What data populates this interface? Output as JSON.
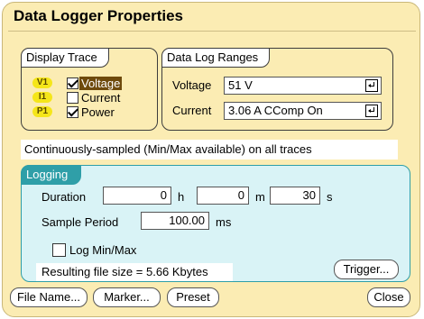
{
  "dialog": {
    "title": "Data Logger Properties"
  },
  "display_trace": {
    "label": "Display Trace",
    "traces": [
      {
        "tag": "V1",
        "label": "Voltage",
        "checked": true,
        "selected": true
      },
      {
        "tag": "I1",
        "label": "Current",
        "checked": false,
        "selected": false
      },
      {
        "tag": "P1",
        "label": "Power",
        "checked": true,
        "selected": false
      }
    ]
  },
  "data_log_ranges": {
    "label": "Data Log Ranges",
    "voltage_label": "Voltage",
    "voltage_value": "51 V",
    "current_label": "Current",
    "current_value": "3.06 A CComp On"
  },
  "sampling_info": "Continuously-sampled (Min/Max available)  on all traces",
  "logging": {
    "label": "Logging",
    "duration_label": "Duration",
    "hours_value": "0",
    "hours_unit": "h",
    "minutes_value": "0",
    "minutes_unit": "m",
    "seconds_value": "30",
    "seconds_unit": "s",
    "sample_period_label": "Sample Period",
    "sample_period_value": "100.00",
    "sample_period_unit": "ms",
    "log_minmax_label": "Log Min/Max",
    "log_minmax_checked": false,
    "result_text": "Resulting file size = 5.66 Kbytes",
    "trigger_label": "Trigger..."
  },
  "buttons": {
    "file_name": "File Name...",
    "marker": "Marker...",
    "preset": "Preset",
    "close": "Close"
  }
}
